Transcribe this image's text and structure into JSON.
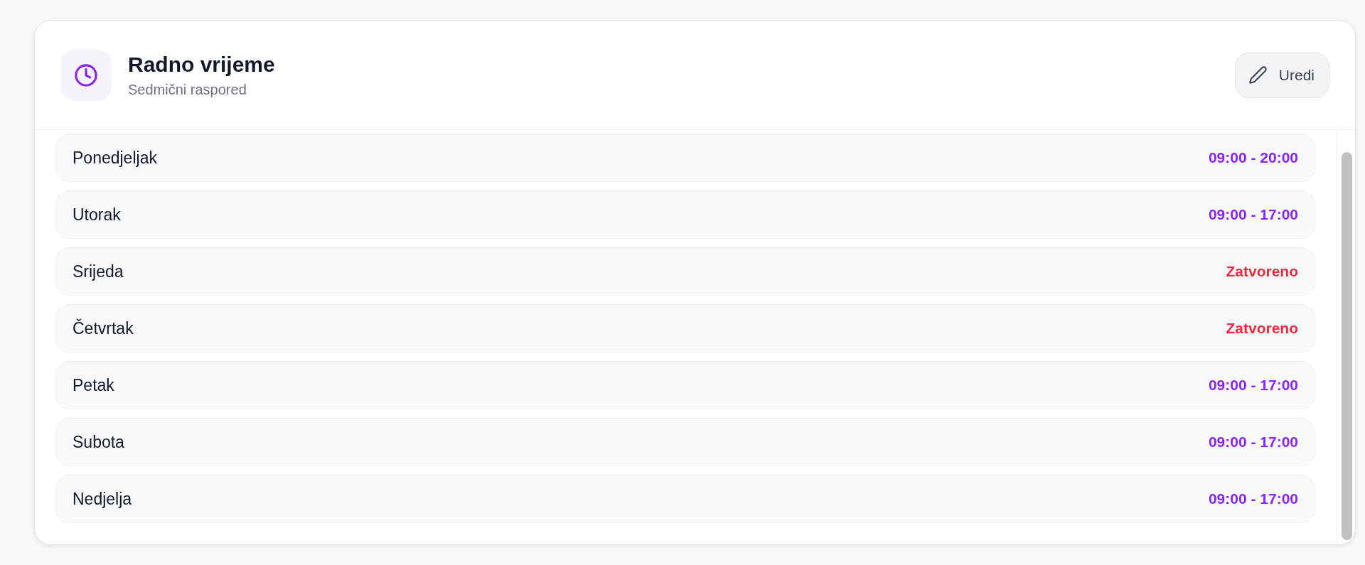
{
  "header": {
    "title": "Radno vrijeme",
    "subtitle": "Sedmični raspored",
    "edit_button": "Uredi"
  },
  "days": [
    {
      "day": "Ponedjeljak",
      "kind": "open",
      "hours": "09:00 - 20:00"
    },
    {
      "day": "Utorak",
      "kind": "open",
      "hours": "09:00 - 17:00"
    },
    {
      "day": "Srijeda",
      "kind": "closed",
      "hours": "Zatvoreno"
    },
    {
      "day": "Četvrtak",
      "kind": "closed",
      "hours": "Zatvoreno"
    },
    {
      "day": "Petak",
      "kind": "open",
      "hours": "09:00 - 17:00"
    },
    {
      "day": "Subota",
      "kind": "open",
      "hours": "09:00 - 17:00"
    },
    {
      "day": "Nedjelja",
      "kind": "open",
      "hours": "09:00 - 17:00"
    }
  ]
}
